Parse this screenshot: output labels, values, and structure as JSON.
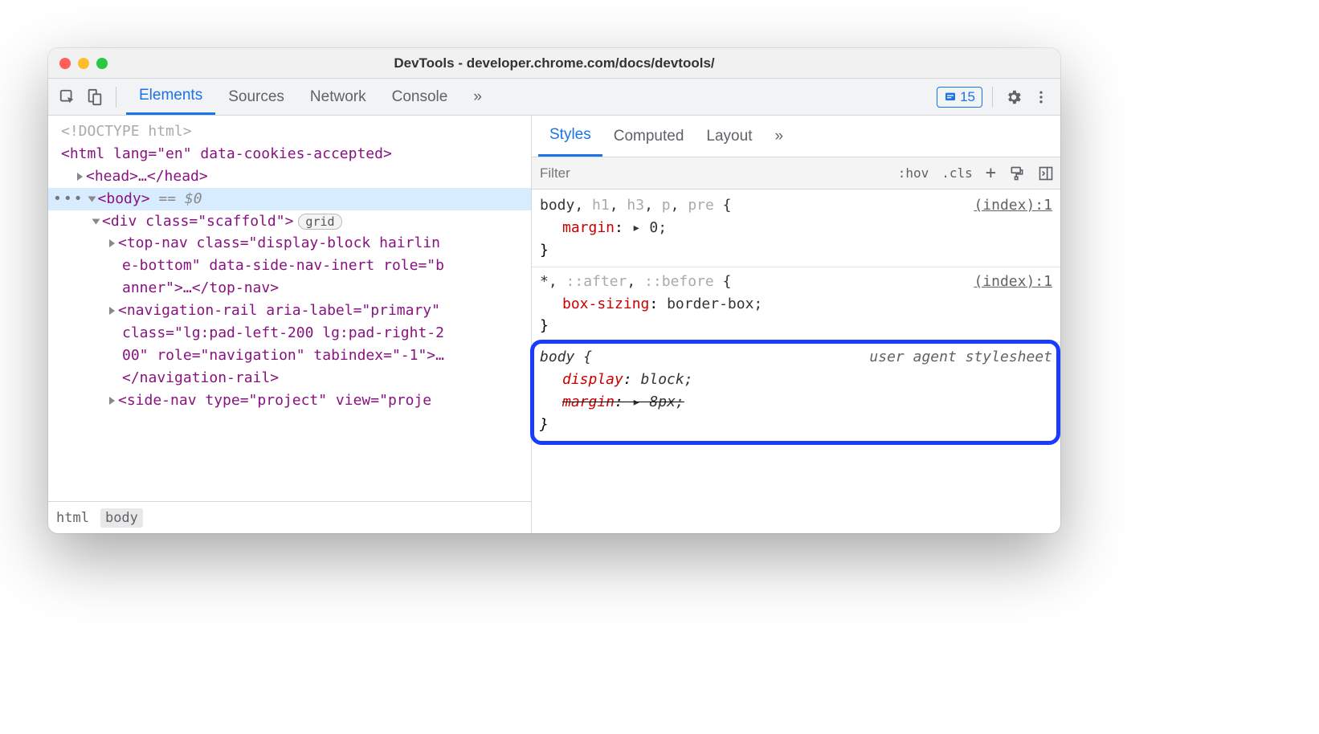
{
  "window": {
    "title": "DevTools - developer.chrome.com/docs/devtools/"
  },
  "toolbar": {
    "tabs": [
      "Elements",
      "Sources",
      "Network",
      "Console"
    ],
    "active_tab": "Elements",
    "issue_count": "15"
  },
  "dom": {
    "doctype": "<!DOCTYPE html>",
    "html_open": "<html lang=\"en\" data-cookies-accepted>",
    "head": "<head>…</head>",
    "body_label": "<body>",
    "body_suffix": " == $0",
    "div_open": "<div class=\"scaffold\">",
    "div_pill": "grid",
    "topnav_l1": "<top-nav class=\"display-block hairlin",
    "topnav_l2": "e-bottom\" data-side-nav-inert role=\"b",
    "topnav_l3": "anner\">…</top-nav>",
    "navrail_l1": "<navigation-rail aria-label=\"primary\"",
    "navrail_l2": "class=\"lg:pad-left-200 lg:pad-right-2",
    "navrail_l3": "00\" role=\"navigation\" tabindex=\"-1\">…",
    "navrail_l4": "</navigation-rail>",
    "sidenav_l1": "<side-nav type=\"project\" view=\"proje"
  },
  "crumbs": [
    "html",
    "body"
  ],
  "styles_panel": {
    "tabs": [
      "Styles",
      "Computed",
      "Layout"
    ],
    "active_tab": "Styles",
    "filter_placeholder": "Filter",
    "hov": ":hov",
    "cls": ".cls",
    "rules": [
      {
        "selector_parts": [
          {
            "t": "body",
            "dim": false
          },
          {
            "t": ", ",
            "dim": false
          },
          {
            "t": "h1",
            "dim": true
          },
          {
            "t": ", ",
            "dim": false
          },
          {
            "t": "h3",
            "dim": true
          },
          {
            "t": ", ",
            "dim": false
          },
          {
            "t": "p",
            "dim": true
          },
          {
            "t": ", ",
            "dim": false
          },
          {
            "t": "pre",
            "dim": true
          },
          {
            "t": " {",
            "dim": false
          }
        ],
        "source": "(index):1",
        "props": [
          {
            "name": "margin",
            "value": "▸ 0",
            "strike": false
          }
        ],
        "ua": false
      },
      {
        "selector_parts": [
          {
            "t": "*",
            "dim": false
          },
          {
            "t": ", ",
            "dim": false
          },
          {
            "t": "::after",
            "dim": true
          },
          {
            "t": ", ",
            "dim": false
          },
          {
            "t": "::before",
            "dim": true
          },
          {
            "t": " {",
            "dim": false
          }
        ],
        "source": "(index):1",
        "props": [
          {
            "name": "box-sizing",
            "value": "border-box",
            "strike": false
          }
        ],
        "ua": false
      },
      {
        "selector_parts": [
          {
            "t": "body {",
            "dim": false
          }
        ],
        "source": "user agent stylesheet",
        "props": [
          {
            "name": "display",
            "value": "block",
            "strike": false
          },
          {
            "name": "margin",
            "value": "▸ 8px",
            "strike": true
          }
        ],
        "ua": true
      }
    ]
  }
}
